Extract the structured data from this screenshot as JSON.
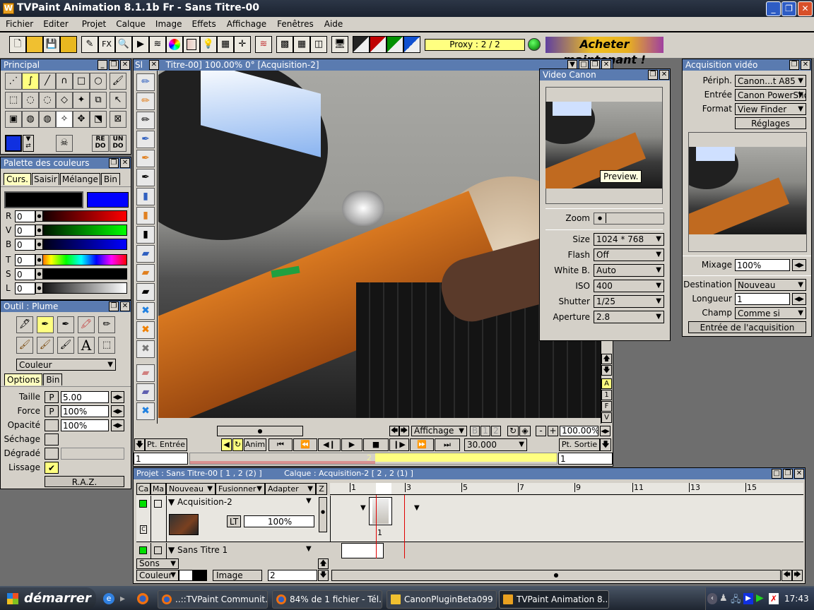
{
  "window": {
    "title": "TVPaint Animation 8.1.1b Fr - Sans Titre-00"
  },
  "menu": [
    "Fichier",
    "Editer",
    "Projet",
    "Calque",
    "Image",
    "Effets",
    "Affichage",
    "Fenêtres",
    "Aide"
  ],
  "toolbar": {
    "fx_label": "FX",
    "proxy": "Proxy : 2 / 2",
    "buy": "Acheter maintenant !",
    "status_color": "#22aa22"
  },
  "principal": {
    "title": "Principal",
    "redo": "RE DO",
    "undo": "UN DO"
  },
  "palette": {
    "title": "Palette des couleurs",
    "tabs": [
      "Curs.",
      "Saisir",
      "Mélange",
      "Bin"
    ],
    "primary_color": "#000000",
    "secondary_color": "#0000ff",
    "channels": [
      {
        "label": "R",
        "value": "0"
      },
      {
        "label": "V",
        "value": "0"
      },
      {
        "label": "B",
        "value": "0"
      },
      {
        "label": "T",
        "value": "0"
      },
      {
        "label": "S",
        "value": "0"
      },
      {
        "label": "L",
        "value": "0"
      }
    ]
  },
  "outil": {
    "title": "Outil : Plume",
    "mode": "Couleur",
    "tabs": [
      "Options",
      "Bin"
    ],
    "taille_label": "Taille",
    "taille": "5.00",
    "force_label": "Force",
    "force": "100%",
    "opacite_label": "Opacité",
    "opacite": "100%",
    "sechage_label": "Séchage",
    "degrade_label": "Dégradé",
    "lissage_label": "Lissage",
    "lissage_checked": true,
    "p": "P",
    "raz": "R.A.Z."
  },
  "view": {
    "tab": "Sl",
    "title": "Titre-00]  100.00%   0°  [Acquisition-2]",
    "affichage": "Affichage",
    "b": "B",
    "one": "1",
    "two": "2",
    "minus": "-",
    "plus": "+",
    "zoom": "100.00%",
    "side": [
      "A",
      "1",
      "F",
      "V"
    ],
    "pt_entree": "Pt. Entrée",
    "anim": "Anim",
    "fps": "30.000",
    "pt_sortie": "Pt. Sortie",
    "in_value": "1",
    "out_value": "1",
    "current_frame": "2"
  },
  "video_canon": {
    "title": "Video Canon",
    "tooltip": "Preview.",
    "zoom_label": "Zoom",
    "settings": [
      {
        "label": "Size",
        "value": "1024 * 768"
      },
      {
        "label": "Flash",
        "value": "Off"
      },
      {
        "label": "White B.",
        "value": "Auto"
      },
      {
        "label": "ISO",
        "value": "400"
      },
      {
        "label": "Shutter",
        "value": "1/25"
      },
      {
        "label": "Aperture",
        "value": "2.8"
      }
    ]
  },
  "acquisition": {
    "title": "Acquisition vidéo",
    "periph_label": "Périph.",
    "periph": "Canon...t A85",
    "entree_label": "Entrée",
    "entree": "Canon PowerSho",
    "format_label": "Format",
    "format": "View Finder",
    "reglages": "Réglages",
    "mixage_label": "Mixage",
    "mixage": "100%",
    "destination_label": "Destination",
    "destination": "Nouveau",
    "longueur_label": "Longueur",
    "longueur": "1",
    "champ_label": "Champ",
    "champ": "Comme si",
    "start": "Entrée de l'acquisition"
  },
  "timeline": {
    "project": "Projet : Sans Titre-00 [ 1 , 2  (2) ]",
    "layer": "Calque : Acquisition-2 [ 2 , 2  (1) ]",
    "headers": [
      "Ca",
      "Ma",
      "Nouveau",
      "Fusionner",
      "Adapter",
      "Z"
    ],
    "ruler": [
      "1",
      "3",
      "5",
      "7",
      "9",
      "11",
      "13",
      "15"
    ],
    "layers": [
      {
        "name": "Acquisition-2",
        "opacity": "100%",
        "lt": "LT",
        "c": "C",
        "frame": "1"
      },
      {
        "name": "Sans Titre 1"
      }
    ],
    "sons": "Sons",
    "couleur": "Couleur",
    "image_label": "Image",
    "image_value": "2"
  },
  "taskbar": {
    "start": "démarrer",
    "tasks": [
      "..::TVPaint Communit...",
      "84% de 1 fichier - Tél...",
      "CanonPluginBeta099",
      "TVPaint Animation 8...."
    ],
    "clock": "17:43"
  }
}
